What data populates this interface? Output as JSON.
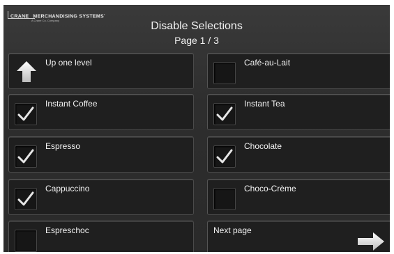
{
  "brand": {
    "name_left": "CRANE",
    "name_right": "MERCHANDISING SYSTEMS",
    "tagline": "A Crane Co. Company"
  },
  "header": {
    "title": "Disable Selections",
    "page_label": "Page 1 / 3"
  },
  "nav": {
    "up_label": "Up one level",
    "next_label": "Next page"
  },
  "selections": [
    {
      "label": "Café-au-Lait",
      "checked": false
    },
    {
      "label": "Instant Coffee",
      "checked": true
    },
    {
      "label": "Instant Tea",
      "checked": true
    },
    {
      "label": "Espresso",
      "checked": true
    },
    {
      "label": "Chocolate",
      "checked": true
    },
    {
      "label": "Cappuccino",
      "checked": true
    },
    {
      "label": "Choco-Crème",
      "checked": false
    },
    {
      "label": "Espreschoc",
      "checked": false
    }
  ],
  "icons": [
    "up-arrow-icon",
    "right-arrow-icon",
    "checkmark-icon"
  ],
  "colors": {
    "background": "#2e2e2e",
    "button": "#1f1f1f",
    "text": "#f2f2f2"
  }
}
